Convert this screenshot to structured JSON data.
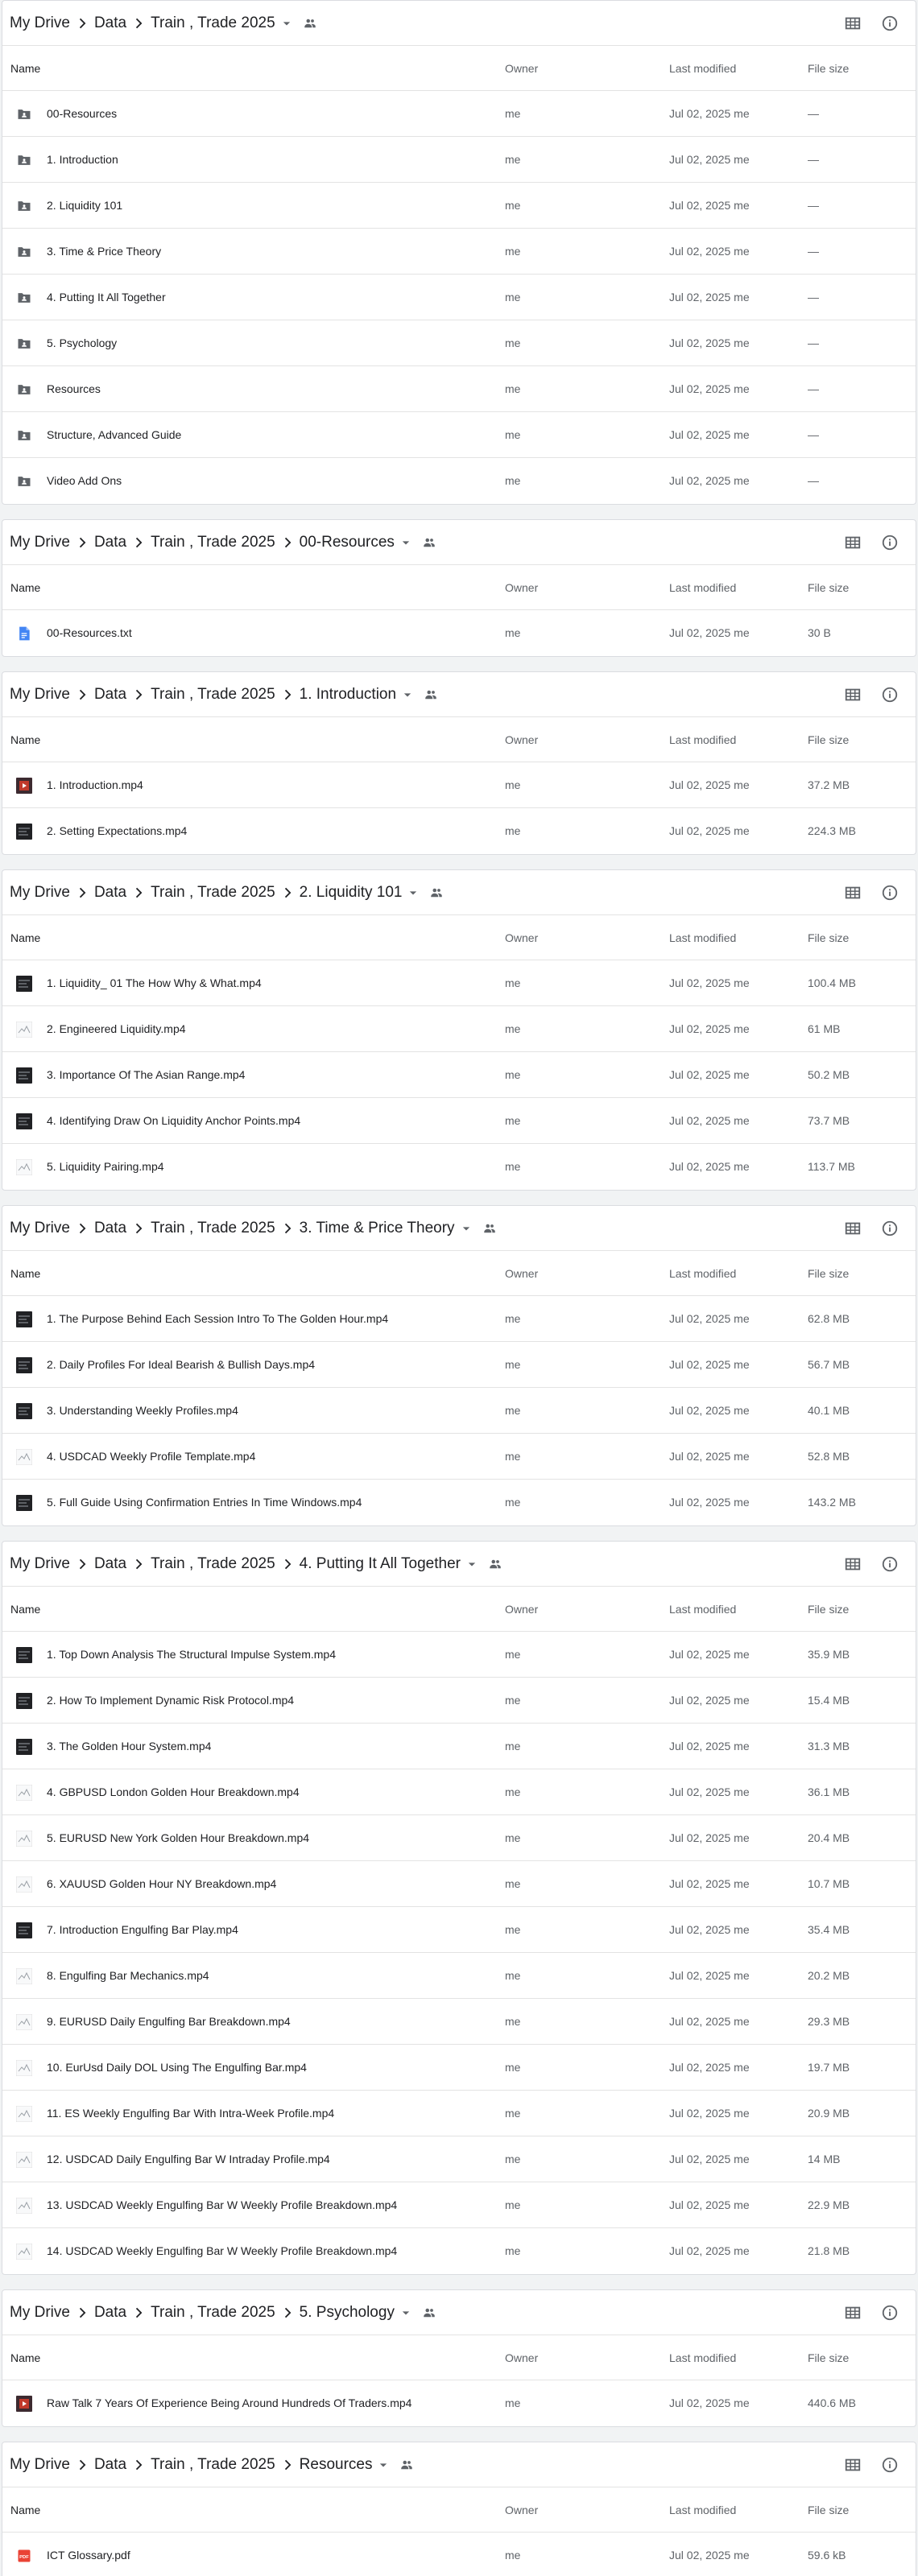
{
  "columns": {
    "name": "Name",
    "owner": "Owner",
    "modified": "Last modified",
    "size": "File size"
  },
  "colors": {
    "folder": "#5f6368",
    "doc_blue": "#4285f4",
    "pdf_red": "#ea4335",
    "dark_thumb": "#202124"
  },
  "panels": [
    {
      "crumbs": [
        "My Drive",
        "Data",
        "Train , Trade 2025"
      ],
      "files": [
        {
          "name": "00-Resources",
          "owner": "me",
          "modified": "Jul 02, 2025 me",
          "size": "—",
          "icon": "folder-shared-icon"
        },
        {
          "name": "1. Introduction",
          "owner": "me",
          "modified": "Jul 02, 2025 me",
          "size": "—",
          "icon": "folder-shared-icon"
        },
        {
          "name": "2. Liquidity 101",
          "owner": "me",
          "modified": "Jul 02, 2025 me",
          "size": "—",
          "icon": "folder-shared-icon"
        },
        {
          "name": "3. Time & Price Theory",
          "owner": "me",
          "modified": "Jul 02, 2025 me",
          "size": "—",
          "icon": "folder-shared-icon"
        },
        {
          "name": "4. Putting It All Together",
          "owner": "me",
          "modified": "Jul 02, 2025 me",
          "size": "—",
          "icon": "folder-shared-icon"
        },
        {
          "name": "5. Psychology",
          "owner": "me",
          "modified": "Jul 02, 2025 me",
          "size": "—",
          "icon": "folder-shared-icon"
        },
        {
          "name": "Resources",
          "owner": "me",
          "modified": "Jul 02, 2025 me",
          "size": "—",
          "icon": "folder-shared-icon"
        },
        {
          "name": "Structure, Advanced Guide",
          "owner": "me",
          "modified": "Jul 02, 2025 me",
          "size": "—",
          "icon": "folder-shared-icon"
        },
        {
          "name": "Video Add Ons",
          "owner": "me",
          "modified": "Jul 02, 2025 me",
          "size": "—",
          "icon": "folder-shared-icon"
        }
      ]
    },
    {
      "crumbs": [
        "My Drive",
        "Data",
        "Train , Trade 2025",
        "00-Resources"
      ],
      "files": [
        {
          "name": "00-Resources.txt",
          "owner": "me",
          "modified": "Jul 02, 2025 me",
          "size": "30 B",
          "icon": "doc-icon"
        }
      ]
    },
    {
      "crumbs": [
        "My Drive",
        "Data",
        "Train , Trade 2025",
        "1. Introduction"
      ],
      "files": [
        {
          "name": "1. Introduction.mp4",
          "owner": "me",
          "modified": "Jul 02, 2025 me",
          "size": "37.2 MB",
          "icon": "video-thumb-red"
        },
        {
          "name": "2. Setting Expectations.mp4",
          "owner": "me",
          "modified": "Jul 02, 2025 me",
          "size": "224.3 MB",
          "icon": "video-thumb-dark"
        }
      ]
    },
    {
      "crumbs": [
        "My Drive",
        "Data",
        "Train , Trade 2025",
        "2. Liquidity 101"
      ],
      "files": [
        {
          "name": "1. Liquidity_ 01 The How Why & What.mp4",
          "owner": "me",
          "modified": "Jul 02, 2025 me",
          "size": "100.4 MB",
          "icon": "video-thumb-dark"
        },
        {
          "name": "2. Engineered Liquidity.mp4",
          "owner": "me",
          "modified": "Jul 02, 2025 me",
          "size": "61 MB",
          "icon": "video-thumb-light"
        },
        {
          "name": "3. Importance Of The Asian Range.mp4",
          "owner": "me",
          "modified": "Jul 02, 2025 me",
          "size": "50.2 MB",
          "icon": "video-thumb-dark"
        },
        {
          "name": "4. Identifying Draw On Liquidity Anchor Points.mp4",
          "owner": "me",
          "modified": "Jul 02, 2025 me",
          "size": "73.7 MB",
          "icon": "video-thumb-dark"
        },
        {
          "name": "5. Liquidity Pairing.mp4",
          "owner": "me",
          "modified": "Jul 02, 2025 me",
          "size": "113.7 MB",
          "icon": "video-thumb-light"
        }
      ]
    },
    {
      "crumbs": [
        "My Drive",
        "Data",
        "Train , Trade 2025",
        "3. Time & Price Theory"
      ],
      "files": [
        {
          "name": "1. The Purpose Behind Each Session Intro To The Golden Hour.mp4",
          "owner": "me",
          "modified": "Jul 02, 2025 me",
          "size": "62.8 MB",
          "icon": "video-thumb-dark"
        },
        {
          "name": "2. Daily Profiles For Ideal Bearish & Bullish Days.mp4",
          "owner": "me",
          "modified": "Jul 02, 2025 me",
          "size": "56.7 MB",
          "icon": "video-thumb-dark"
        },
        {
          "name": "3. Understanding Weekly Profiles.mp4",
          "owner": "me",
          "modified": "Jul 02, 2025 me",
          "size": "40.1 MB",
          "icon": "video-thumb-dark"
        },
        {
          "name": "4. USDCAD Weekly Profile Template.mp4",
          "owner": "me",
          "modified": "Jul 02, 2025 me",
          "size": "52.8 MB",
          "icon": "video-thumb-light"
        },
        {
          "name": "5. Full Guide Using Confirmation Entries In Time Windows.mp4",
          "owner": "me",
          "modified": "Jul 02, 2025 me",
          "size": "143.2 MB",
          "icon": "video-thumb-dark"
        }
      ]
    },
    {
      "crumbs": [
        "My Drive",
        "Data",
        "Train , Trade 2025",
        "4. Putting It All Together"
      ],
      "files": [
        {
          "name": "1. Top Down Analysis The Structural Impulse System.mp4",
          "owner": "me",
          "modified": "Jul 02, 2025 me",
          "size": "35.9 MB",
          "icon": "video-thumb-dark"
        },
        {
          "name": "2. How To Implement Dynamic Risk Protocol.mp4",
          "owner": "me",
          "modified": "Jul 02, 2025 me",
          "size": "15.4 MB",
          "icon": "video-thumb-dark"
        },
        {
          "name": "3. The Golden Hour System.mp4",
          "owner": "me",
          "modified": "Jul 02, 2025 me",
          "size": "31.3 MB",
          "icon": "video-thumb-dark"
        },
        {
          "name": "4. GBPUSD London Golden Hour Breakdown.mp4",
          "owner": "me",
          "modified": "Jul 02, 2025 me",
          "size": "36.1 MB",
          "icon": "video-thumb-light"
        },
        {
          "name": "5. EURUSD New York Golden Hour Breakdown.mp4",
          "owner": "me",
          "modified": "Jul 02, 2025 me",
          "size": "20.4 MB",
          "icon": "video-thumb-light"
        },
        {
          "name": "6. XAUUSD Golden Hour NY Breakdown.mp4",
          "owner": "me",
          "modified": "Jul 02, 2025 me",
          "size": "10.7 MB",
          "icon": "video-thumb-light"
        },
        {
          "name": "7. Introduction Engulfing Bar Play.mp4",
          "owner": "me",
          "modified": "Jul 02, 2025 me",
          "size": "35.4 MB",
          "icon": "video-thumb-dark"
        },
        {
          "name": "8. Engulfing Bar Mechanics.mp4",
          "owner": "me",
          "modified": "Jul 02, 2025 me",
          "size": "20.2 MB",
          "icon": "video-thumb-light"
        },
        {
          "name": "9. EURUSD Daily Engulfing Bar Breakdown.mp4",
          "owner": "me",
          "modified": "Jul 02, 2025 me",
          "size": "29.3 MB",
          "icon": "video-thumb-light"
        },
        {
          "name": "10. EurUsd Daily DOL Using The Engulfing Bar.mp4",
          "owner": "me",
          "modified": "Jul 02, 2025 me",
          "size": "19.7 MB",
          "icon": "video-thumb-light"
        },
        {
          "name": "11. ES Weekly Engulfing Bar With Intra-Week Profile.mp4",
          "owner": "me",
          "modified": "Jul 02, 2025 me",
          "size": "20.9 MB",
          "icon": "video-thumb-light"
        },
        {
          "name": "12. USDCAD Daily Engulfing Bar W Intraday Profile.mp4",
          "owner": "me",
          "modified": "Jul 02, 2025 me",
          "size": "14 MB",
          "icon": "video-thumb-light"
        },
        {
          "name": "13. USDCAD Weekly Engulfing Bar W Weekly Profile Breakdown.mp4",
          "owner": "me",
          "modified": "Jul 02, 2025 me",
          "size": "22.9 MB",
          "icon": "video-thumb-light"
        },
        {
          "name": "14. USDCAD Weekly Engulfing Bar W Weekly Profile Breakdown.mp4",
          "owner": "me",
          "modified": "Jul 02, 2025 me",
          "size": "21.8 MB",
          "icon": "video-thumb-light"
        }
      ]
    },
    {
      "crumbs": [
        "My Drive",
        "Data",
        "Train , Trade 2025",
        "5. Psychology"
      ],
      "files": [
        {
          "name": "Raw Talk 7 Years Of Experience Being Around Hundreds Of Traders.mp4",
          "owner": "me",
          "modified": "Jul 02, 2025 me",
          "size": "440.6 MB",
          "icon": "video-thumb-red"
        }
      ]
    },
    {
      "crumbs": [
        "My Drive",
        "Data",
        "Train , Trade 2025",
        "Resources"
      ],
      "files": [
        {
          "name": "ICT Glossary.pdf",
          "owner": "me",
          "modified": "Jul 02, 2025 me",
          "size": "59.6 kB",
          "icon": "pdf-icon"
        }
      ]
    }
  ]
}
